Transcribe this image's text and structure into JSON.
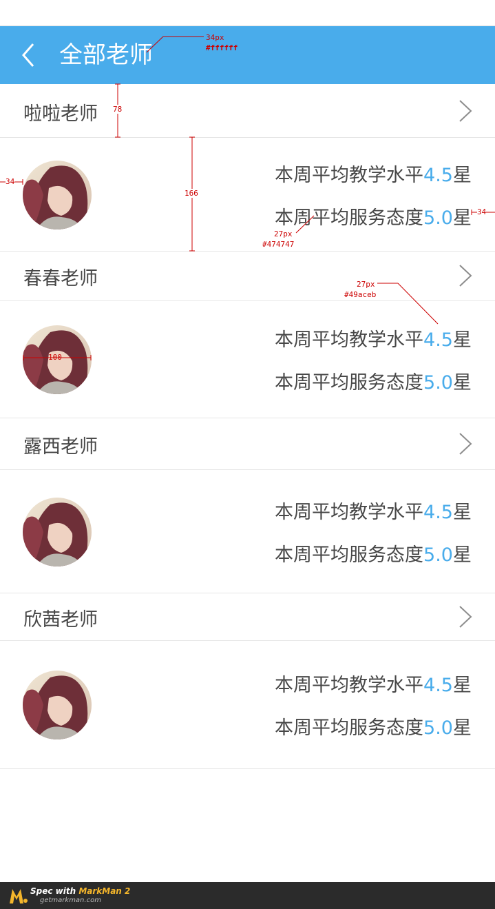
{
  "header": {
    "title": "全部老师",
    "back_icon": "chevron-left-icon",
    "background": "#49aceb",
    "title_color": "#ffffff"
  },
  "teachers": [
    {
      "name": "啦啦老师",
      "teaching_label": "本周平均教学水平",
      "teaching_score": "4.5",
      "service_label": "本周平均服务态度",
      "service_score": "5.0",
      "unit": "星"
    },
    {
      "name": "春春老师",
      "teaching_label": "本周平均教学水平",
      "teaching_score": "4.5",
      "service_label": "本周平均服务态度",
      "service_score": "5.0",
      "unit": "星"
    },
    {
      "name": "露西老师",
      "teaching_label": "本周平均教学水平",
      "teaching_score": "4.5",
      "service_label": "本周平均服务态度",
      "service_score": "5.0",
      "unit": "星"
    },
    {
      "name": "欣茜老师",
      "teaching_label": "本周平均教学水平",
      "teaching_score": "4.5",
      "service_label": "本周平均服务态度",
      "service_score": "5.0",
      "unit": "星"
    }
  ],
  "colors": {
    "text": "#474747",
    "accent": "#49aceb"
  },
  "annotations": {
    "title_size": "34px",
    "title_color": "#ffffff",
    "row_height": "78",
    "body_height": "166",
    "margin_left": "34",
    "margin_right": "34",
    "text_size": "27px",
    "text_color": "#474747",
    "accent_size": "27px",
    "accent_color": "#49aceb",
    "avatar_size": "100"
  },
  "footer": {
    "line1_prefix": "Spec with ",
    "line1_brand": "MarkMan 2",
    "line2": "getmarkman.com"
  }
}
